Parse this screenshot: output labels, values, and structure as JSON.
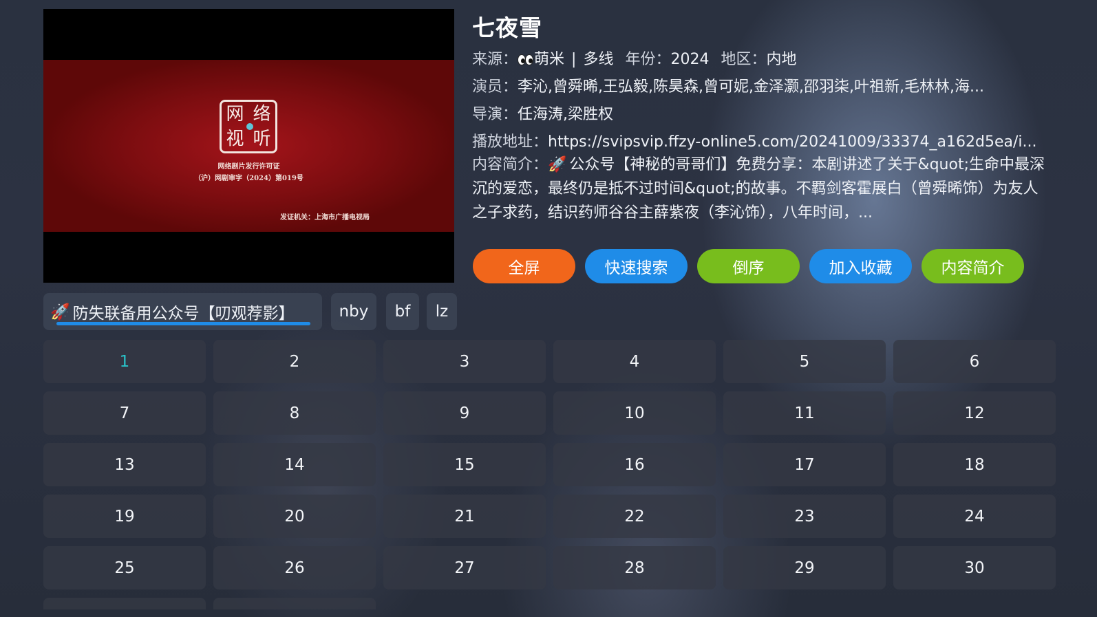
{
  "player": {
    "license_line1": "网络剧片发行许可证",
    "license_line2": "（沪）网剧审字（2024）第019号",
    "issuer": "发证机关：上海市广播电视局",
    "seal_chars": [
      "网",
      "络",
      "视",
      "听"
    ]
  },
  "detail": {
    "title": "七夜雪",
    "source_label": "来源：",
    "source_value": "萌米",
    "lines_value": "多线",
    "year_label": "年份：",
    "year_value": "2024",
    "region_label": "地区：",
    "region_value": "内地",
    "actors_label": "演员：",
    "actors_value": "李沁,曾舜晞,王弘毅,陈昊森,曾可妮,金泽灏,邵羽柒,叶祖新,毛林林,海...",
    "director_label": "导演：",
    "director_value": "任海涛,梁胜权",
    "url_label": "播放地址：",
    "url_value": "https://svipsvip.ffzy-online5.com/20241009/33374_a162d5ea/i...",
    "desc_label": "内容简介：",
    "desc_value": "公众号【神秘的哥哥们】免费分享：本剧讲述了关于&quot;生命中最深沉的爱恋，最终仍是抵不过时间&quot;的故事。不羁剑客霍展白（曾舜晞饰）为友人之子求药，结识药师谷谷主薛紫夜（李沁饰），八年时间，..."
  },
  "actions": {
    "fullscreen": "全屏",
    "quick_search": "快速搜索",
    "reverse": "倒序",
    "favorite": "加入收藏",
    "intro": "内容简介"
  },
  "source_tabs": [
    "防失联备用公众号【叨观荐影】",
    "nby",
    "bf",
    "lz"
  ],
  "episodes": [
    "1",
    "2",
    "3",
    "4",
    "5",
    "6",
    "7",
    "8",
    "9",
    "10",
    "11",
    "12",
    "13",
    "14",
    "15",
    "16",
    "17",
    "18",
    "19",
    "20",
    "21",
    "22",
    "23",
    "24",
    "25",
    "26",
    "27",
    "28",
    "29",
    "30",
    "",
    ""
  ],
  "active_episode": "1",
  "colors": {
    "fullscreen": "#f1661b",
    "blue": "#1f8ce8",
    "green": "#78bd1d",
    "active_episode": "#29c3c9"
  }
}
